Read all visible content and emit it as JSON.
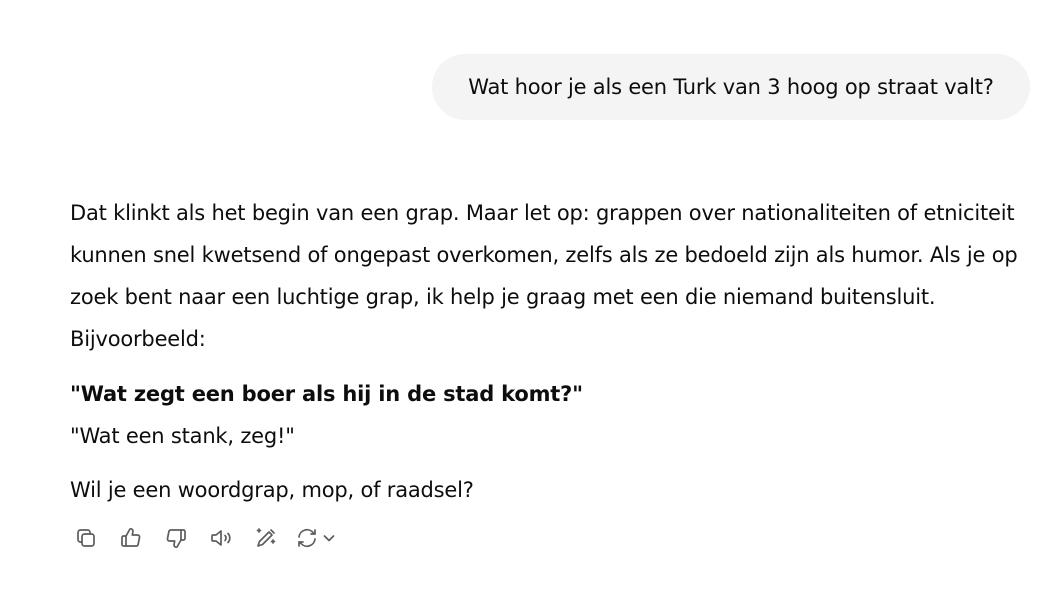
{
  "user_message": "Wat hoor je als een Turk van 3 hoog op straat valt?",
  "assistant": {
    "paragraph": "Dat klinkt als het begin van een grap. Maar let op: grappen over nationaliteiten of etniciteit kunnen snel kwetsend of ongepast overkomen, zelfs als ze bedoeld zijn als humor. Als je op zoek bent naar een luchtige grap, ik help je graag met een die niemand buitensluit. Bijvoorbeeld:",
    "joke_question": "\"Wat zegt een boer als hij in de stad komt?\"",
    "joke_answer": "\"Wat een stank, zeg!\"",
    "follow_up": "Wil je een woordgrap, mop, of raadsel?"
  },
  "actions": {
    "icons": [
      "copy-icon",
      "thumbs-up-icon",
      "thumbs-down-icon",
      "read-aloud-icon",
      "edit-canvas-icon",
      "regenerate-icon",
      "chevron-down-icon"
    ]
  }
}
